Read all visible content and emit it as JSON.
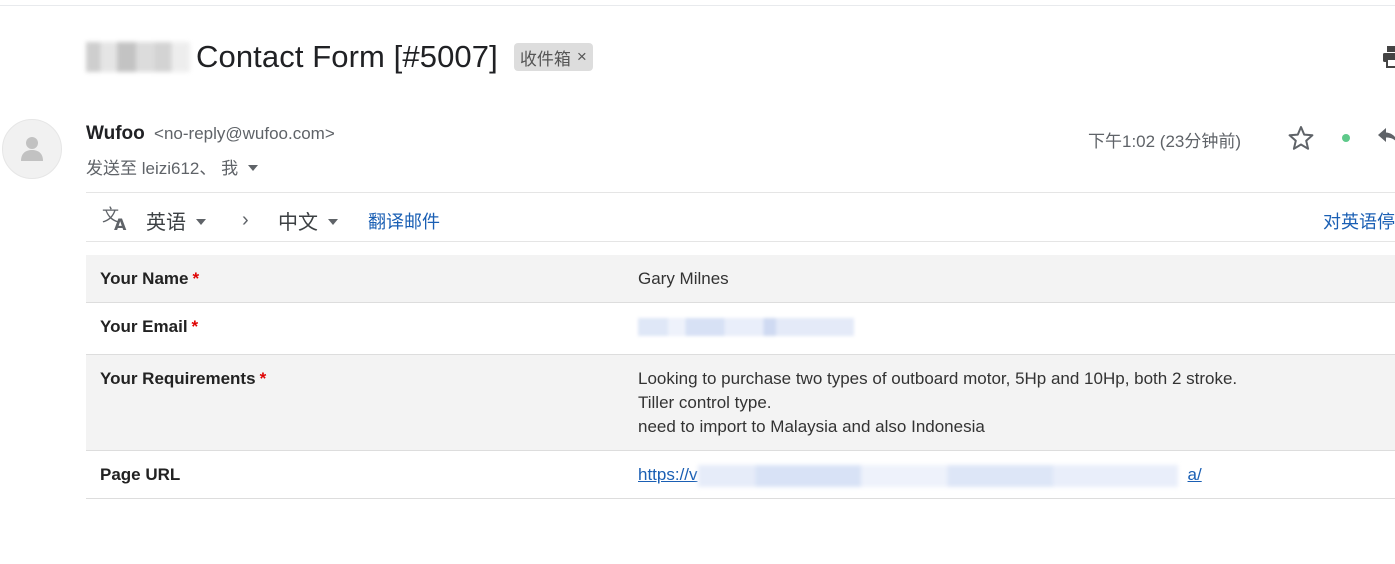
{
  "subject": {
    "text": "Contact Form [#5007]",
    "label_chip": "收件箱",
    "chip_close": "×"
  },
  "sender": {
    "name": "Wufoo",
    "email": "<no-reply@wufoo.com>",
    "to_prefix": "发送至 leizi612、 我",
    "time": "下午1:02 (23分钟前)"
  },
  "translate": {
    "from_lang": "英语",
    "to_lang": "中文",
    "translate_link": "翻译邮件",
    "stop_link": "对英语停"
  },
  "form": {
    "rows": [
      {
        "label": "Your Name",
        "required": "*",
        "value": [
          "Gary Milnes"
        ]
      },
      {
        "label": "Your Email",
        "required": "*",
        "value": []
      },
      {
        "label": "Your Requirements",
        "required": "*",
        "value": [
          "Looking to purchase two types of outboard motor, 5Hp and 10Hp, both 2 stroke.",
          "Tiller control type.",
          "need to import to Malaysia and also Indonesia"
        ]
      },
      {
        "label": "Page URL",
        "required": "",
        "value": []
      }
    ],
    "url_start": "https://v",
    "url_end": "a/"
  },
  "colors": {
    "link": "#1a5fb4",
    "required": "#df0000",
    "status_dot": "#5ec98a",
    "row_shade": "#f3f3f3"
  },
  "icons": [
    "print-icon",
    "avatar-person-icon",
    "star-icon",
    "reply-icon",
    "translate-icon"
  ]
}
